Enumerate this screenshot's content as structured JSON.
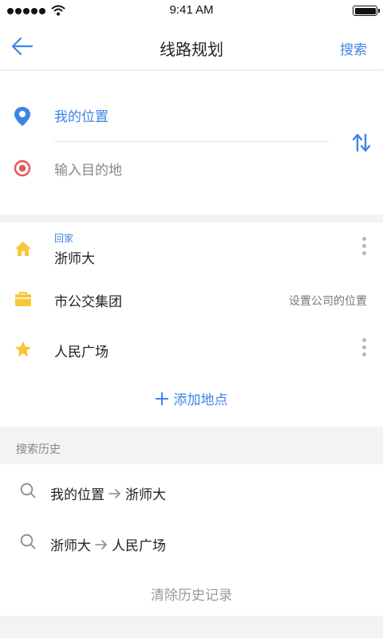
{
  "status_bar": {
    "time": "9:41 AM"
  },
  "nav": {
    "title": "线路规划",
    "action_label": "搜索"
  },
  "route": {
    "origin": "我的位置",
    "destination_placeholder": "输入目的地"
  },
  "places": {
    "home": {
      "tag": "回家",
      "name": "浙师大"
    },
    "company": {
      "name": "市公交集团",
      "hint": "设置公司的位置"
    },
    "favorite": {
      "name": "人民广场"
    },
    "add_label": "添加地点"
  },
  "history": {
    "header": "搜索历史",
    "items": [
      {
        "from": "我的位置",
        "to": "浙师大"
      },
      {
        "from": "浙师大",
        "to": "人民广场"
      }
    ],
    "clear_label": "清除历史记录"
  },
  "colors": {
    "accent": "#3f84e5",
    "destination": "#e85454",
    "place_icon": "#f7c73b"
  },
  "icons": [
    "back-arrow-icon",
    "location-pin-icon",
    "target-icon",
    "swap-icon",
    "home-icon",
    "briefcase-icon",
    "star-icon",
    "more-icon",
    "plus-icon",
    "search-icon",
    "arrow-right-icon"
  ]
}
